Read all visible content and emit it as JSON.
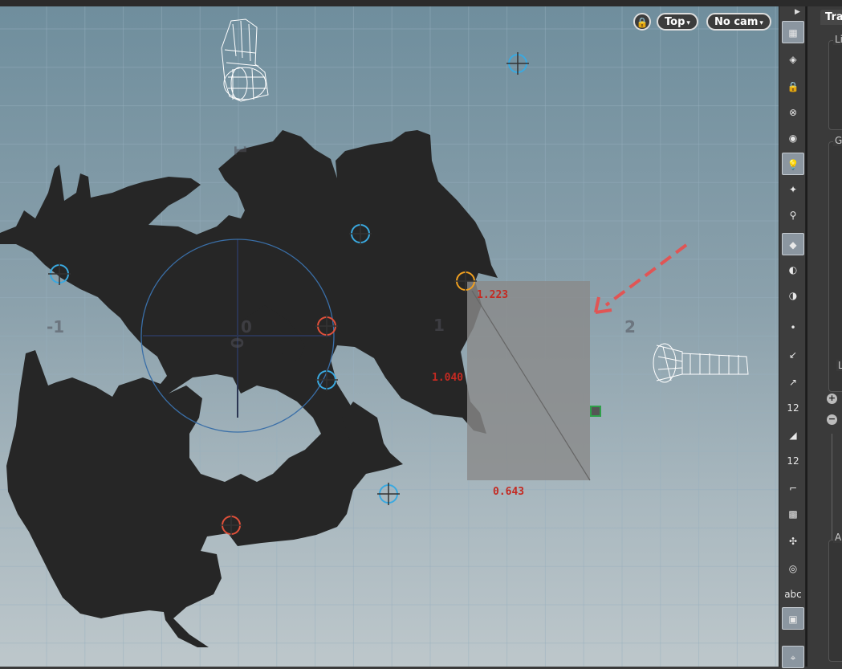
{
  "viewport": {
    "view_menu_label": "Top",
    "camera_menu_label": "No cam",
    "axis_labels": {
      "x_neg1": "-1",
      "x_0": "0",
      "x_1": "1",
      "x_2": "2",
      "y_1": "1",
      "y_0": "0"
    },
    "measurements": {
      "width": "0.643",
      "height": "1.040",
      "diagonal": "1.223"
    },
    "colors": {
      "map_fill": "#262626",
      "light_blue": "#3aa9e0",
      "light_red": "#e0503a",
      "light_orange": "#f0a020",
      "measure_red": "#c42a22",
      "annotation_arrow": "#e05555",
      "selection_box": "#8a8a8a"
    }
  },
  "toolbar": {
    "tools": [
      {
        "icon": "display-options-icon",
        "active": true
      },
      {
        "icon": "geometry-view-icon",
        "active": false
      },
      {
        "icon": "lock-icon",
        "active": false
      },
      {
        "icon": "no-light-icon",
        "active": false
      },
      {
        "icon": "headlight-icon",
        "active": false
      },
      {
        "icon": "normal-light-icon",
        "active": true
      },
      {
        "icon": "high-quality-light-icon",
        "active": false
      },
      {
        "icon": "shadow-light-icon",
        "active": false
      },
      {
        "icon": "shaded-mode-icon",
        "active": true
      },
      {
        "icon": "visualizer-icon",
        "active": false
      },
      {
        "icon": "camera-visualize-icon",
        "active": false
      },
      {
        "icon": "point-display-icon",
        "active": false
      },
      {
        "icon": "point-normal-icon",
        "active": false
      },
      {
        "icon": "vertex-normal-icon",
        "active": false
      },
      {
        "icon": "point-number-icon",
        "active": false,
        "label": "12"
      },
      {
        "icon": "primitive-normal-icon",
        "active": false
      },
      {
        "icon": "primitive-number-icon",
        "active": false,
        "label": "12"
      },
      {
        "icon": "profile-curve-icon",
        "active": false
      },
      {
        "icon": "uv-display-icon",
        "active": false
      },
      {
        "icon": "particle-display-icon",
        "active": false
      },
      {
        "icon": "template-display-icon",
        "active": false
      },
      {
        "icon": "text-display-icon",
        "active": false,
        "label": "abc"
      },
      {
        "icon": "background-image-icon",
        "active": true
      },
      {
        "icon": "location-pin-icon",
        "active": true
      }
    ]
  },
  "panel": {
    "title": "Tra",
    "group1_label": "Lig",
    "group2_label": "Ge",
    "group3_label": "L",
    "group4_label": "Ar",
    "plus": "+",
    "minus": "−"
  }
}
